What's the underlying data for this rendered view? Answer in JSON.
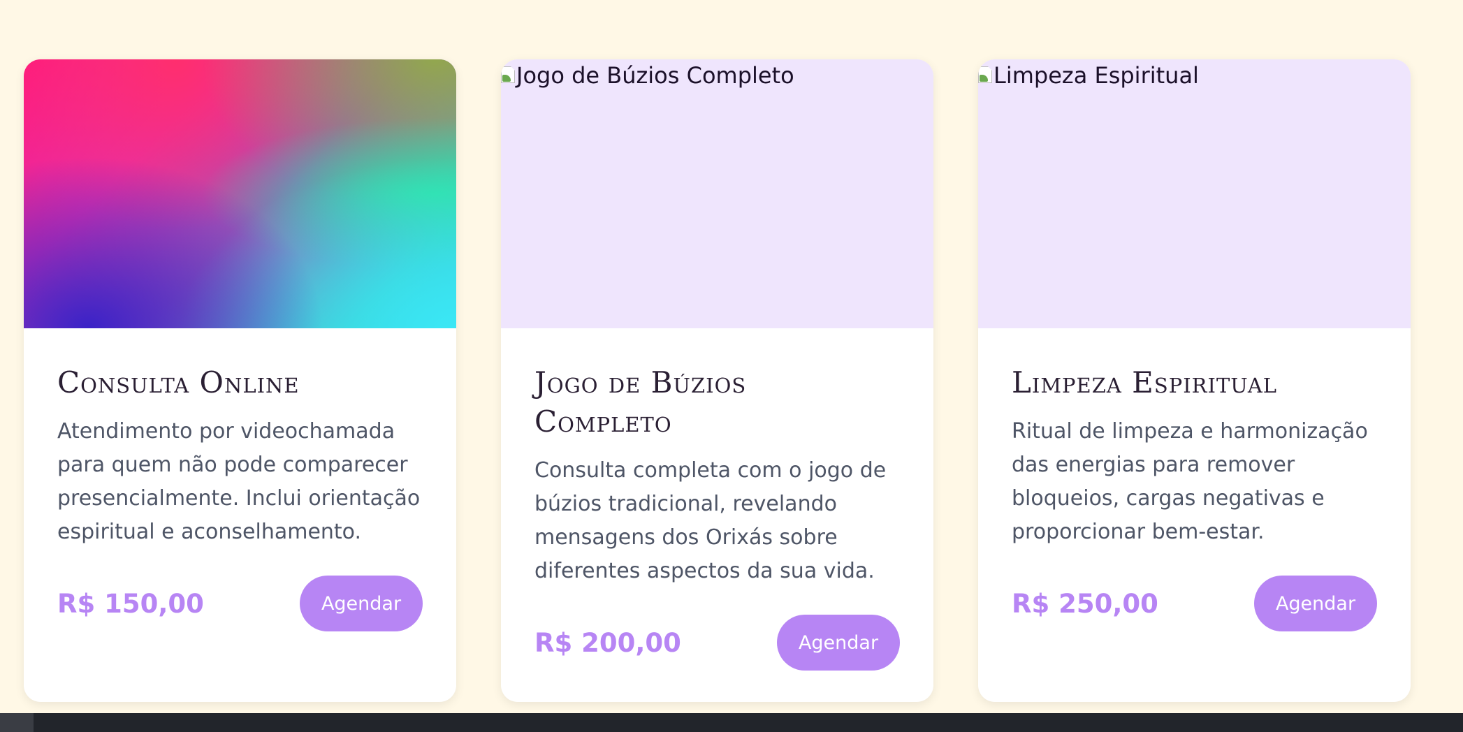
{
  "services": [
    {
      "image_alt": "",
      "image_type": "gradient",
      "title": "Consulta Online",
      "description": "Atendimento por videochamada para quem não pode comparecer presencialmente. Inclui orientação espiritual e aconselhamento.",
      "price": "R$ 150,00",
      "button_label": "Agendar"
    },
    {
      "image_alt": "Jogo de Búzios Completo",
      "image_type": "broken",
      "title": "Jogo de Búzios Completo",
      "description": "Consulta completa com o jogo de búzios tradicional, revelando mensagens dos Orixás sobre diferentes aspectos da sua vida.",
      "price": "R$ 200,00",
      "button_label": "Agendar"
    },
    {
      "image_alt": "Limpeza Espiritual",
      "image_type": "broken",
      "title": "Limpeza Espiritual",
      "description": "Ritual de limpeza e harmonização das energias para remover bloqueios, cargas negativas e proporcionar bem-estar.",
      "price": "R$ 250,00",
      "button_label": "Agendar"
    }
  ],
  "colors": {
    "page_background": "#fff8e6",
    "accent": "#b785f4",
    "image_placeholder": "#efe5fd",
    "title_text": "#2a1f33",
    "body_text": "#4e5566"
  }
}
